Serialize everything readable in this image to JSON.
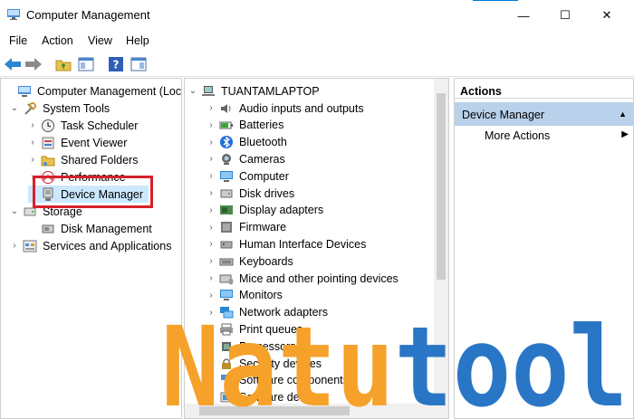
{
  "window": {
    "title": "Computer Management",
    "minimize": "—",
    "maximize": "☐",
    "close": "✕"
  },
  "menu": [
    "File",
    "Action",
    "View",
    "Help"
  ],
  "left_tree": [
    {
      "label": "Computer Management (Local)",
      "icon": "computer-management-icon",
      "chev": ""
    },
    {
      "label": "System Tools",
      "icon": "system-tools-icon",
      "chev": "⌄"
    },
    {
      "label": "Task Scheduler",
      "icon": "clock-icon",
      "chev": "›"
    },
    {
      "label": "Event Viewer",
      "icon": "event-viewer-icon",
      "chev": "›"
    },
    {
      "label": "Shared Folders",
      "icon": "shared-folder-icon",
      "chev": "›"
    },
    {
      "label": "Performance",
      "icon": "performance-icon",
      "chev": "›"
    },
    {
      "label": "Device Manager",
      "icon": "device-manager-icon",
      "chev": ""
    },
    {
      "label": "Storage",
      "icon": "storage-icon",
      "chev": "⌄"
    },
    {
      "label": "Disk Management",
      "icon": "disk-management-icon",
      "chev": ""
    },
    {
      "label": "Services and Applications",
      "icon": "services-icon",
      "chev": "›"
    }
  ],
  "device_tree": {
    "root": "TUANTAMLAPTOP",
    "items": [
      "Audio inputs and outputs",
      "Batteries",
      "Bluetooth",
      "Cameras",
      "Computer",
      "Disk drives",
      "Display adapters",
      "Firmware",
      "Human Interface Devices",
      "Keyboards",
      "Mice and other pointing devices",
      "Monitors",
      "Network adapters",
      "Print queues",
      "Processors",
      "Security devices",
      "Software components",
      "Software devices"
    ]
  },
  "actions": {
    "header": "Actions",
    "selected": "Device Manager",
    "item": "More Actions"
  },
  "watermark": "Natutool",
  "colors": {
    "selection": "#cce8ff",
    "actions_selected": "#b9d1ea",
    "highlight": "#d6202a",
    "watermark_orange": "#f5a12a",
    "watermark_blue": "#2a76c6"
  }
}
